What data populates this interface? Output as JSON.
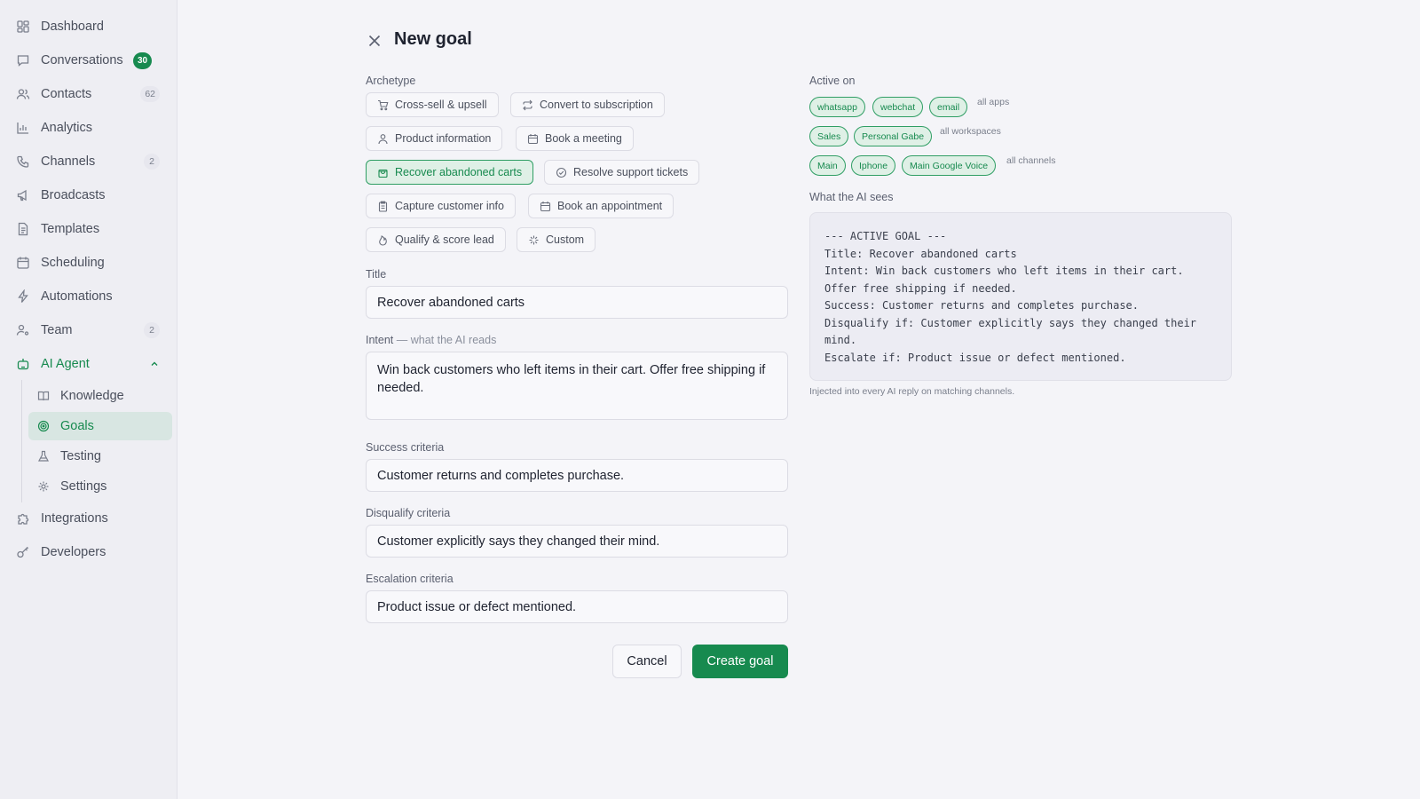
{
  "sidebar": {
    "items": [
      {
        "label": "Dashboard",
        "icon": "dashboard-icon"
      },
      {
        "label": "Conversations",
        "icon": "chat-icon",
        "badge": "30"
      },
      {
        "label": "Contacts",
        "icon": "contacts-icon",
        "count": "62"
      },
      {
        "label": "Analytics",
        "icon": "bar-chart-icon"
      },
      {
        "label": "Channels",
        "icon": "phone-icon",
        "count": "2"
      },
      {
        "label": "Broadcasts",
        "icon": "megaphone-icon"
      },
      {
        "label": "Templates",
        "icon": "document-icon"
      },
      {
        "label": "Scheduling",
        "icon": "calendar-icon"
      },
      {
        "label": "Automations",
        "icon": "lightning-icon"
      },
      {
        "label": "Team",
        "icon": "team-icon",
        "count": "2"
      },
      {
        "label": "AI Agent",
        "icon": "robot-icon"
      },
      {
        "label": "Integrations",
        "icon": "puzzle-icon"
      },
      {
        "label": "Developers",
        "icon": "key-icon"
      }
    ],
    "ai_agent_sub": [
      {
        "label": "Knowledge",
        "icon": "book-icon"
      },
      {
        "label": "Goals",
        "icon": "target-icon"
      },
      {
        "label": "Testing",
        "icon": "flask-icon"
      },
      {
        "label": "Settings",
        "icon": "gear-icon"
      }
    ]
  },
  "header": {
    "title": "New goal"
  },
  "form": {
    "archetype_label": "Archetype",
    "archetypes": [
      {
        "label": "Cross-sell & upsell",
        "icon": "cart-icon"
      },
      {
        "label": "Convert to subscription",
        "icon": "repeat-icon"
      },
      {
        "label": "Product information",
        "icon": "user-icon"
      },
      {
        "label": "Book a meeting",
        "icon": "calendar-icon"
      },
      {
        "label": "Recover abandoned carts",
        "icon": "bag-icon"
      },
      {
        "label": "Resolve support tickets",
        "icon": "check-circle-icon"
      },
      {
        "label": "Capture customer info",
        "icon": "clipboard-icon"
      },
      {
        "label": "Book an appointment",
        "icon": "calendar-icon"
      },
      {
        "label": "Qualify & score lead",
        "icon": "flame-icon"
      },
      {
        "label": "Custom",
        "icon": "sparkle-icon"
      }
    ],
    "selected_archetype": "Recover abandoned carts",
    "title_label": "Title",
    "title_value": "Recover abandoned carts",
    "intent_label": "Intent",
    "intent_sub": " — what the AI reads",
    "intent_value": "Win back customers who left items in their cart. Offer free shipping if needed.",
    "success_label": "Success criteria",
    "success_value": "Customer returns and completes purchase.",
    "disqualify_label": "Disqualify criteria",
    "disqualify_value": "Customer explicitly says they changed their mind.",
    "escalation_label": "Escalation criteria",
    "escalation_value": "Product issue or defect mentioned.",
    "cancel_label": "Cancel",
    "create_label": "Create goal"
  },
  "active_on": {
    "label": "Active on",
    "apps": [
      "whatsapp",
      "webchat",
      "email"
    ],
    "apps_note": "all apps",
    "workspaces": [
      "Sales",
      "Personal Gabe"
    ],
    "workspaces_note": "all workspaces",
    "channels": [
      "Main",
      "Iphone",
      "Main Google Voice"
    ],
    "channels_note": "all channels"
  },
  "preview": {
    "label": "What the AI sees",
    "text": "--- ACTIVE GOAL ---\nTitle: Recover abandoned carts\nIntent: Win back customers who left items in their cart.\nOffer free shipping if needed.\nSuccess: Customer returns and completes purchase.\nDisqualify if: Customer explicitly says they changed their\nmind.\nEscalate if: Product issue or defect mentioned.",
    "note": "Injected into every AI reply on matching channels."
  },
  "colors": {
    "accent": "#178a4f",
    "accent_bg": "#dff0e6",
    "sidebar_bg": "#eeeef3",
    "page_bg": "#f4f4f8"
  }
}
